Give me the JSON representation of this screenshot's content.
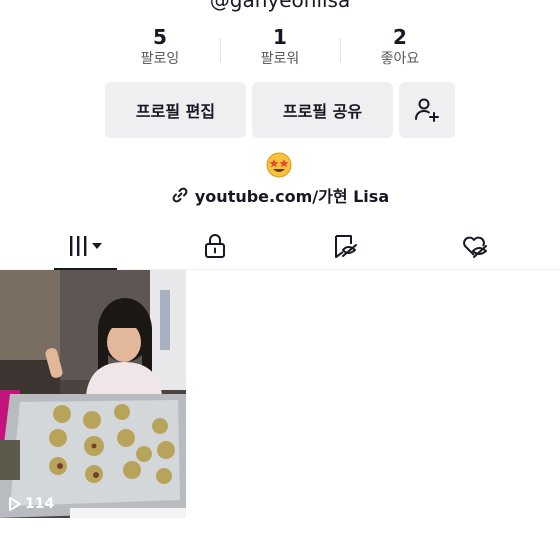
{
  "profile": {
    "handle": "@ganyeonlisa",
    "stats": [
      {
        "value": "5",
        "label": "팔로잉"
      },
      {
        "value": "1",
        "label": "팔로워"
      },
      {
        "value": "2",
        "label": "좋아요"
      }
    ],
    "buttons": {
      "edit_profile": "프로필 편집",
      "share_profile": "프로필 공유"
    },
    "link": "youtube.com/가현 Lisa"
  },
  "tabs": [
    {
      "icon": "grid-icon",
      "active": true
    },
    {
      "icon": "lock-icon",
      "active": false
    },
    {
      "icon": "saved-eye-icon",
      "active": false
    },
    {
      "icon": "liked-eye-icon",
      "active": false
    }
  ],
  "videos": [
    {
      "views": "114"
    }
  ],
  "colors": {
    "text": "#161823",
    "button_bg": "#efeff1",
    "secondary_text": "#57585e"
  }
}
